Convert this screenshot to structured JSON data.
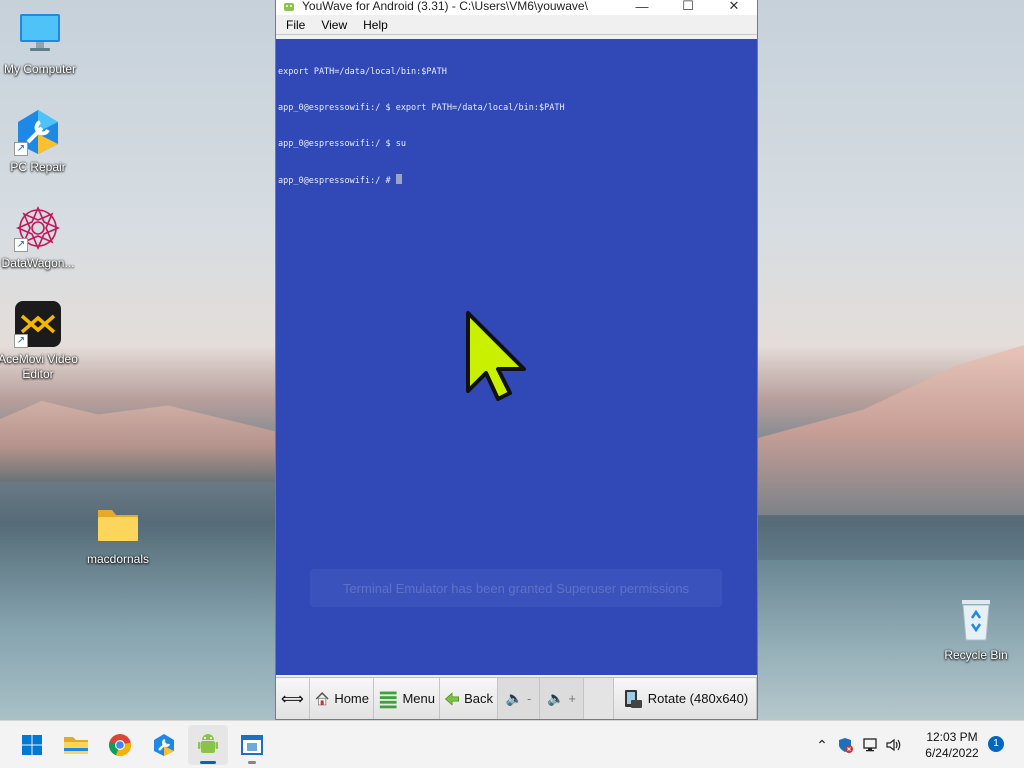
{
  "desktop": {
    "icons": [
      {
        "label": "My Computer",
        "icon": "monitor-icon"
      },
      {
        "label": "PC Repair",
        "icon": "wrench-icon"
      },
      {
        "label": "DataWagon...",
        "icon": "mandala-icon"
      },
      {
        "label": "AceMovi Video Editor",
        "icon": "acemovi-icon"
      },
      {
        "label": "macdornals",
        "icon": "folder-icon"
      },
      {
        "label": "Recycle Bin",
        "icon": "recycle-bin-icon"
      }
    ]
  },
  "window": {
    "title": "YouWave for Android (3.31) - C:\\Users\\VM6\\youwave\\",
    "menu": [
      "File",
      "View",
      "Help"
    ],
    "terminal_lines": [
      "export PATH=/data/local/bin:$PATH",
      "app_0@espressowifi:/ $ export PATH=/data/local/bin:$PATH",
      "app_0@espressowifi:/ $ su",
      "app_0@espressowifi:/ # "
    ],
    "toast": "Terminal Emulator has been granted Superuser permissions",
    "toolbar": {
      "home": "Home",
      "menu": "Menu",
      "back": "Back",
      "vol_down": "-",
      "vol_up": "+",
      "rotate": "Rotate (480x640)"
    },
    "colors": {
      "screen": "#3049b6",
      "pointer": "#c8f000"
    }
  },
  "taskbar": {
    "apps": [
      "start-icon",
      "file-explorer-icon",
      "chrome-icon",
      "pc-repair-icon",
      "youwave-icon",
      "window-icon"
    ],
    "time": "12:03 PM",
    "date": "6/24/2022",
    "notifications": "1"
  }
}
